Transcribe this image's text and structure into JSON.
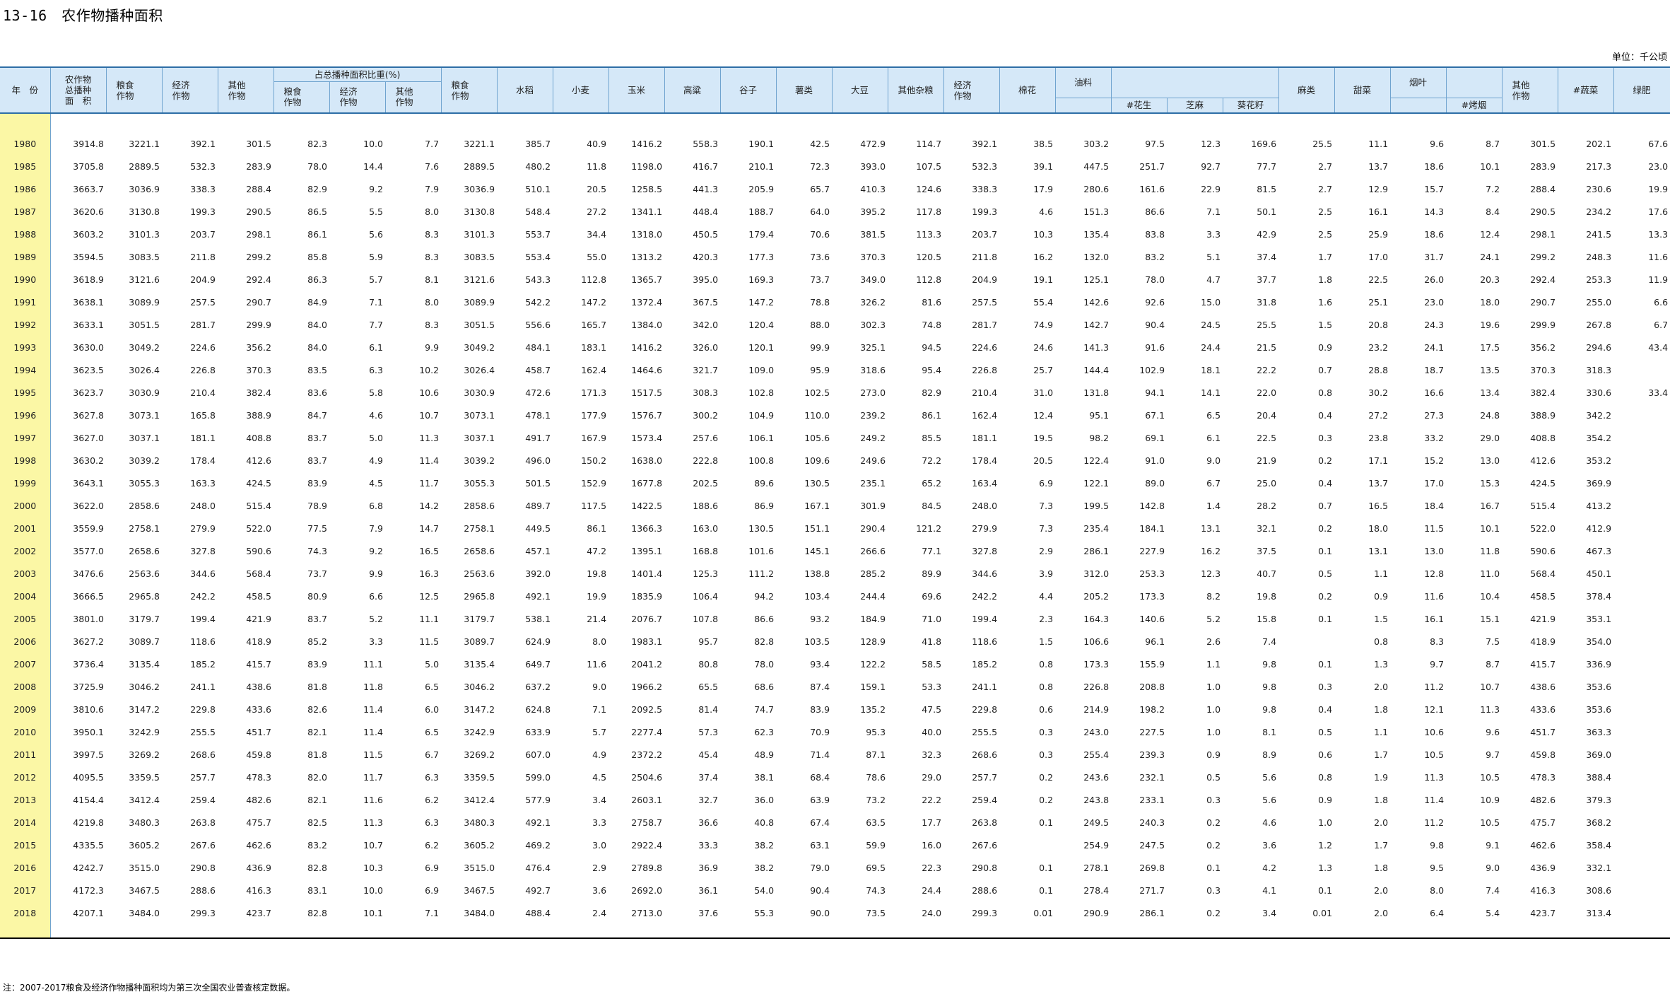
{
  "title": "13-16　农作物播种面积",
  "unit": "单位：千公顷",
  "headers": {
    "year": "年　份",
    "total": "农作物\n总播种\n面　积",
    "grain": "粮食\n作物",
    "econ": "经济\n作物",
    "other": "其他\n作物",
    "share_group": "占总播种面积比重(%)",
    "share_grain": "粮食\n作物",
    "share_econ": "经济\n作物",
    "share_other": "其他\n作物",
    "grain2": "粮食\n作物",
    "rice": "水稻",
    "wheat": "小麦",
    "corn": "玉米",
    "sorghum": "高粱",
    "millet": "谷子",
    "tuber": "薯类",
    "soy": "大豆",
    "misc_grain": "其他杂粮",
    "econ2": "经济\n作物",
    "cotton": "棉花",
    "oil": "油料",
    "peanut": "#花生",
    "sesame": "芝麻",
    "sunflower": "葵花籽",
    "hemp": "麻类",
    "beet": "甜菜",
    "tobacco": "烟叶",
    "flue_tobacco": "#烤烟",
    "other2": "其他\n作物",
    "veg": "#蔬菜",
    "green_manure": "绿肥"
  },
  "rows": [
    [
      "1980",
      "3914.8",
      "3221.1",
      "392.1",
      "301.5",
      "82.3",
      "10.0",
      "7.7",
      "3221.1",
      "385.7",
      "40.9",
      "1416.2",
      "558.3",
      "190.1",
      "42.5",
      "472.9",
      "114.7",
      "392.1",
      "38.5",
      "303.2",
      "97.5",
      "12.3",
      "169.6",
      "25.5",
      "11.1",
      "9.6",
      "8.7",
      "301.5",
      "202.1",
      "67.6"
    ],
    [
      "1985",
      "3705.8",
      "2889.5",
      "532.3",
      "283.9",
      "78.0",
      "14.4",
      "7.6",
      "2889.5",
      "480.2",
      "11.8",
      "1198.0",
      "416.7",
      "210.1",
      "72.3",
      "393.0",
      "107.5",
      "532.3",
      "39.1",
      "447.5",
      "251.7",
      "92.7",
      "77.7",
      "2.7",
      "13.7",
      "18.6",
      "10.1",
      "283.9",
      "217.3",
      "23.0"
    ],
    [
      "1986",
      "3663.7",
      "3036.9",
      "338.3",
      "288.4",
      "82.9",
      "9.2",
      "7.9",
      "3036.9",
      "510.1",
      "20.5",
      "1258.5",
      "441.3",
      "205.9",
      "65.7",
      "410.3",
      "124.6",
      "338.3",
      "17.9",
      "280.6",
      "161.6",
      "22.9",
      "81.5",
      "2.7",
      "12.9",
      "15.7",
      "7.2",
      "288.4",
      "230.6",
      "19.9"
    ],
    [
      "1987",
      "3620.6",
      "3130.8",
      "199.3",
      "290.5",
      "86.5",
      "5.5",
      "8.0",
      "3130.8",
      "548.4",
      "27.2",
      "1341.1",
      "448.4",
      "188.7",
      "64.0",
      "395.2",
      "117.8",
      "199.3",
      "4.6",
      "151.3",
      "86.6",
      "7.1",
      "50.1",
      "2.5",
      "16.1",
      "14.3",
      "8.4",
      "290.5",
      "234.2",
      "17.6"
    ],
    [
      "1988",
      "3603.2",
      "3101.3",
      "203.7",
      "298.1",
      "86.1",
      "5.6",
      "8.3",
      "3101.3",
      "553.7",
      "34.4",
      "1318.0",
      "450.5",
      "179.4",
      "70.6",
      "381.5",
      "113.3",
      "203.7",
      "10.3",
      "135.4",
      "83.8",
      "3.3",
      "42.9",
      "2.5",
      "25.9",
      "18.6",
      "12.4",
      "298.1",
      "241.5",
      "13.3"
    ],
    [
      "1989",
      "3594.5",
      "3083.5",
      "211.8",
      "299.2",
      "85.8",
      "5.9",
      "8.3",
      "3083.5",
      "553.4",
      "55.0",
      "1313.2",
      "420.3",
      "177.3",
      "73.6",
      "370.3",
      "120.5",
      "211.8",
      "16.2",
      "132.0",
      "83.2",
      "5.1",
      "37.4",
      "1.7",
      "17.0",
      "31.7",
      "24.1",
      "299.2",
      "248.3",
      "11.6"
    ],
    [
      "1990",
      "3618.9",
      "3121.6",
      "204.9",
      "292.4",
      "86.3",
      "5.7",
      "8.1",
      "3121.6",
      "543.3",
      "112.8",
      "1365.7",
      "395.0",
      "169.3",
      "73.7",
      "349.0",
      "112.8",
      "204.9",
      "19.1",
      "125.1",
      "78.0",
      "4.7",
      "37.7",
      "1.8",
      "22.5",
      "26.0",
      "20.3",
      "292.4",
      "253.3",
      "11.9"
    ],
    [
      "1991",
      "3638.1",
      "3089.9",
      "257.5",
      "290.7",
      "84.9",
      "7.1",
      "8.0",
      "3089.9",
      "542.2",
      "147.2",
      "1372.4",
      "367.5",
      "147.2",
      "78.8",
      "326.2",
      "81.6",
      "257.5",
      "55.4",
      "142.6",
      "92.6",
      "15.0",
      "31.8",
      "1.6",
      "25.1",
      "23.0",
      "18.0",
      "290.7",
      "255.0",
      "6.6"
    ],
    [
      "1992",
      "3633.1",
      "3051.5",
      "281.7",
      "299.9",
      "84.0",
      "7.7",
      "8.3",
      "3051.5",
      "556.6",
      "165.7",
      "1384.0",
      "342.0",
      "120.4",
      "88.0",
      "302.3",
      "74.8",
      "281.7",
      "74.9",
      "142.7",
      "90.4",
      "24.5",
      "25.5",
      "1.5",
      "20.8",
      "24.3",
      "19.6",
      "299.9",
      "267.8",
      "6.7"
    ],
    [
      "1993",
      "3630.0",
      "3049.2",
      "224.6",
      "356.2",
      "84.0",
      "6.1",
      "9.9",
      "3049.2",
      "484.1",
      "183.1",
      "1416.2",
      "326.0",
      "120.1",
      "99.9",
      "325.1",
      "94.5",
      "224.6",
      "24.6",
      "141.3",
      "91.6",
      "24.4",
      "21.5",
      "0.9",
      "23.2",
      "24.1",
      "17.5",
      "356.2",
      "294.6",
      "43.4"
    ],
    [
      "1994",
      "3623.5",
      "3026.4",
      "226.8",
      "370.3",
      "83.5",
      "6.3",
      "10.2",
      "3026.4",
      "458.7",
      "162.4",
      "1464.6",
      "321.7",
      "109.0",
      "95.9",
      "318.6",
      "95.4",
      "226.8",
      "25.7",
      "144.4",
      "102.9",
      "18.1",
      "22.2",
      "0.7",
      "28.8",
      "18.7",
      "13.5",
      "370.3",
      "318.3",
      ""
    ],
    [
      "1995",
      "3623.7",
      "3030.9",
      "210.4",
      "382.4",
      "83.6",
      "5.8",
      "10.6",
      "3030.9",
      "472.6",
      "171.3",
      "1517.5",
      "308.3",
      "102.8",
      "102.5",
      "273.0",
      "82.9",
      "210.4",
      "31.0",
      "131.8",
      "94.1",
      "14.1",
      "22.0",
      "0.8",
      "30.2",
      "16.6",
      "13.4",
      "382.4",
      "330.6",
      "33.4"
    ],
    [
      "1996",
      "3627.8",
      "3073.1",
      "165.8",
      "388.9",
      "84.7",
      "4.6",
      "10.7",
      "3073.1",
      "478.1",
      "177.9",
      "1576.7",
      "300.2",
      "104.9",
      "110.0",
      "239.2",
      "86.1",
      "162.4",
      "12.4",
      "95.1",
      "67.1",
      "6.5",
      "20.4",
      "0.4",
      "27.2",
      "27.3",
      "24.8",
      "388.9",
      "342.2",
      ""
    ],
    [
      "1997",
      "3627.0",
      "3037.1",
      "181.1",
      "408.8",
      "83.7",
      "5.0",
      "11.3",
      "3037.1",
      "491.7",
      "167.9",
      "1573.4",
      "257.6",
      "106.1",
      "105.6",
      "249.2",
      "85.5",
      "181.1",
      "19.5",
      "98.2",
      "69.1",
      "6.1",
      "22.5",
      "0.3",
      "23.8",
      "33.2",
      "29.0",
      "408.8",
      "354.2",
      ""
    ],
    [
      "1998",
      "3630.2",
      "3039.2",
      "178.4",
      "412.6",
      "83.7",
      "4.9",
      "11.4",
      "3039.2",
      "496.0",
      "150.2",
      "1638.0",
      "222.8",
      "100.8",
      "109.6",
      "249.6",
      "72.2",
      "178.4",
      "20.5",
      "122.4",
      "91.0",
      "9.0",
      "21.9",
      "0.2",
      "17.1",
      "15.2",
      "13.0",
      "412.6",
      "353.2",
      ""
    ],
    [
      "1999",
      "3643.1",
      "3055.3",
      "163.3",
      "424.5",
      "83.9",
      "4.5",
      "11.7",
      "3055.3",
      "501.5",
      "152.9",
      "1677.8",
      "202.5",
      "89.6",
      "130.5",
      "235.1",
      "65.2",
      "163.4",
      "6.9",
      "122.1",
      "89.0",
      "6.7",
      "25.0",
      "0.4",
      "13.7",
      "17.0",
      "15.3",
      "424.5",
      "369.9",
      ""
    ],
    [
      "2000",
      "3622.0",
      "2858.6",
      "248.0",
      "515.4",
      "78.9",
      "6.8",
      "14.2",
      "2858.6",
      "489.7",
      "117.5",
      "1422.5",
      "188.6",
      "86.9",
      "167.1",
      "301.9",
      "84.5",
      "248.0",
      "7.3",
      "199.5",
      "142.8",
      "1.4",
      "28.2",
      "0.7",
      "16.5",
      "18.4",
      "16.7",
      "515.4",
      "413.2",
      ""
    ],
    [
      "2001",
      "3559.9",
      "2758.1",
      "279.9",
      "522.0",
      "77.5",
      "7.9",
      "14.7",
      "2758.1",
      "449.5",
      "86.1",
      "1366.3",
      "163.0",
      "130.5",
      "151.1",
      "290.4",
      "121.2",
      "279.9",
      "7.3",
      "235.4",
      "184.1",
      "13.1",
      "32.1",
      "0.2",
      "18.0",
      "11.5",
      "10.1",
      "522.0",
      "412.9",
      ""
    ],
    [
      "2002",
      "3577.0",
      "2658.6",
      "327.8",
      "590.6",
      "74.3",
      "9.2",
      "16.5",
      "2658.6",
      "457.1",
      "47.2",
      "1395.1",
      "168.8",
      "101.6",
      "145.1",
      "266.6",
      "77.1",
      "327.8",
      "2.9",
      "286.1",
      "227.9",
      "16.2",
      "37.5",
      "0.1",
      "13.1",
      "13.0",
      "11.8",
      "590.6",
      "467.3",
      ""
    ],
    [
      "2003",
      "3476.6",
      "2563.6",
      "344.6",
      "568.4",
      "73.7",
      "9.9",
      "16.3",
      "2563.6",
      "392.0",
      "19.8",
      "1401.4",
      "125.3",
      "111.2",
      "138.8",
      "285.2",
      "89.9",
      "344.6",
      "3.9",
      "312.0",
      "253.3",
      "12.3",
      "40.7",
      "0.5",
      "1.1",
      "12.8",
      "11.0",
      "568.4",
      "450.1",
      ""
    ],
    [
      "2004",
      "3666.5",
      "2965.8",
      "242.2",
      "458.5",
      "80.9",
      "6.6",
      "12.5",
      "2965.8",
      "492.1",
      "19.9",
      "1835.9",
      "106.4",
      "94.2",
      "103.4",
      "244.4",
      "69.6",
      "242.2",
      "4.4",
      "205.2",
      "173.3",
      "8.2",
      "19.8",
      "0.2",
      "0.9",
      "11.6",
      "10.4",
      "458.5",
      "378.4",
      ""
    ],
    [
      "2005",
      "3801.0",
      "3179.7",
      "199.4",
      "421.9",
      "83.7",
      "5.2",
      "11.1",
      "3179.7",
      "538.1",
      "21.4",
      "2076.7",
      "107.8",
      "86.6",
      "93.2",
      "184.9",
      "71.0",
      "199.4",
      "2.3",
      "164.3",
      "140.6",
      "5.2",
      "15.8",
      "0.1",
      "1.5",
      "16.1",
      "15.1",
      "421.9",
      "353.1",
      ""
    ],
    [
      "2006",
      "3627.2",
      "3089.7",
      "118.6",
      "418.9",
      "85.2",
      "3.3",
      "11.5",
      "3089.7",
      "624.9",
      "8.0",
      "1983.1",
      "95.7",
      "82.8",
      "103.5",
      "128.9",
      "41.8",
      "118.6",
      "1.5",
      "106.6",
      "96.1",
      "2.6",
      "7.4",
      "",
      "0.8",
      "8.3",
      "7.5",
      "418.9",
      "354.0",
      ""
    ],
    [
      "2007",
      "3736.4",
      "3135.4",
      "185.2",
      "415.7",
      "83.9",
      "11.1",
      "5.0",
      "3135.4",
      "649.7",
      "11.6",
      "2041.2",
      "80.8",
      "78.0",
      "93.4",
      "122.2",
      "58.5",
      "185.2",
      "0.8",
      "173.3",
      "155.9",
      "1.1",
      "9.8",
      "0.1",
      "1.3",
      "9.7",
      "8.7",
      "415.7",
      "336.9",
      ""
    ],
    [
      "2008",
      "3725.9",
      "3046.2",
      "241.1",
      "438.6",
      "81.8",
      "11.8",
      "6.5",
      "3046.2",
      "637.2",
      "9.0",
      "1966.2",
      "65.5",
      "68.6",
      "87.4",
      "159.1",
      "53.3",
      "241.1",
      "0.8",
      "226.8",
      "208.8",
      "1.0",
      "9.8",
      "0.3",
      "2.0",
      "11.2",
      "10.7",
      "438.6",
      "353.6",
      ""
    ],
    [
      "2009",
      "3810.6",
      "3147.2",
      "229.8",
      "433.6",
      "82.6",
      "11.4",
      "6.0",
      "3147.2",
      "624.8",
      "7.1",
      "2092.5",
      "81.4",
      "74.7",
      "83.9",
      "135.2",
      "47.5",
      "229.8",
      "0.6",
      "214.9",
      "198.2",
      "1.0",
      "9.8",
      "0.4",
      "1.8",
      "12.1",
      "11.3",
      "433.6",
      "353.6",
      ""
    ],
    [
      "2010",
      "3950.1",
      "3242.9",
      "255.5",
      "451.7",
      "82.1",
      "11.4",
      "6.5",
      "3242.9",
      "633.9",
      "5.7",
      "2277.4",
      "57.3",
      "62.3",
      "70.9",
      "95.3",
      "40.0",
      "255.5",
      "0.3",
      "243.0",
      "227.5",
      "1.0",
      "8.1",
      "0.5",
      "1.1",
      "10.6",
      "9.6",
      "451.7",
      "363.3",
      ""
    ],
    [
      "2011",
      "3997.5",
      "3269.2",
      "268.6",
      "459.8",
      "81.8",
      "11.5",
      "6.7",
      "3269.2",
      "607.0",
      "4.9",
      "2372.2",
      "45.4",
      "48.9",
      "71.4",
      "87.1",
      "32.3",
      "268.6",
      "0.3",
      "255.4",
      "239.3",
      "0.9",
      "8.9",
      "0.6",
      "1.7",
      "10.5",
      "9.7",
      "459.8",
      "369.0",
      ""
    ],
    [
      "2012",
      "4095.5",
      "3359.5",
      "257.7",
      "478.3",
      "82.0",
      "11.7",
      "6.3",
      "3359.5",
      "599.0",
      "4.5",
      "2504.6",
      "37.4",
      "38.1",
      "68.4",
      "78.6",
      "29.0",
      "257.7",
      "0.2",
      "243.6",
      "232.1",
      "0.5",
      "5.6",
      "0.8",
      "1.9",
      "11.3",
      "10.5",
      "478.3",
      "388.4",
      ""
    ],
    [
      "2013",
      "4154.4",
      "3412.4",
      "259.4",
      "482.6",
      "82.1",
      "11.6",
      "6.2",
      "3412.4",
      "577.9",
      "3.4",
      "2603.1",
      "32.7",
      "36.0",
      "63.9",
      "73.2",
      "22.2",
      "259.4",
      "0.2",
      "243.8",
      "233.1",
      "0.3",
      "5.6",
      "0.9",
      "1.8",
      "11.4",
      "10.9",
      "482.6",
      "379.3",
      ""
    ],
    [
      "2014",
      "4219.8",
      "3480.3",
      "263.8",
      "475.7",
      "82.5",
      "11.3",
      "6.3",
      "3480.3",
      "492.1",
      "3.3",
      "2758.7",
      "36.6",
      "40.8",
      "67.4",
      "63.5",
      "17.7",
      "263.8",
      "0.1",
      "249.5",
      "240.3",
      "0.2",
      "4.6",
      "1.0",
      "2.0",
      "11.2",
      "10.5",
      "475.7",
      "368.2",
      ""
    ],
    [
      "2015",
      "4335.5",
      "3605.2",
      "267.6",
      "462.6",
      "83.2",
      "10.7",
      "6.2",
      "3605.2",
      "469.2",
      "3.0",
      "2922.4",
      "33.3",
      "38.2",
      "63.1",
      "59.9",
      "16.0",
      "267.6",
      "",
      "254.9",
      "247.5",
      "0.2",
      "3.6",
      "1.2",
      "1.7",
      "9.8",
      "9.1",
      "462.6",
      "358.4",
      ""
    ],
    [
      "2016",
      "4242.7",
      "3515.0",
      "290.8",
      "436.9",
      "82.8",
      "10.3",
      "6.9",
      "3515.0",
      "476.4",
      "2.9",
      "2789.8",
      "36.9",
      "38.2",
      "79.0",
      "69.5",
      "22.3",
      "290.8",
      "0.1",
      "278.1",
      "269.8",
      "0.1",
      "4.2",
      "1.3",
      "1.8",
      "9.5",
      "9.0",
      "436.9",
      "332.1",
      ""
    ],
    [
      "2017",
      "4172.3",
      "3467.5",
      "288.6",
      "416.3",
      "83.1",
      "10.0",
      "6.9",
      "3467.5",
      "492.7",
      "3.6",
      "2692.0",
      "36.1",
      "54.0",
      "90.4",
      "74.3",
      "24.4",
      "288.6",
      "0.1",
      "278.4",
      "271.7",
      "0.3",
      "4.1",
      "0.1",
      "2.0",
      "8.0",
      "7.4",
      "416.3",
      "308.6",
      ""
    ],
    [
      "2018",
      "4207.1",
      "3484.0",
      "299.3",
      "423.7",
      "82.8",
      "10.1",
      "7.1",
      "3484.0",
      "488.4",
      "2.4",
      "2713.0",
      "37.6",
      "55.3",
      "90.0",
      "73.5",
      "24.0",
      "299.3",
      "0.01",
      "290.9",
      "286.1",
      "0.2",
      "3.4",
      "0.01",
      "2.0",
      "6.4",
      "5.4",
      "423.7",
      "313.4",
      ""
    ]
  ],
  "note": "注：2007-2017粮食及经济作物播种面积均为第三次全国农业普查核定数据。",
  "colors": {
    "header_bg": "#d5e8f8",
    "year_bg": "#fbf7a5",
    "border": "#6fa3cf",
    "rule": "#2e6ea6"
  }
}
